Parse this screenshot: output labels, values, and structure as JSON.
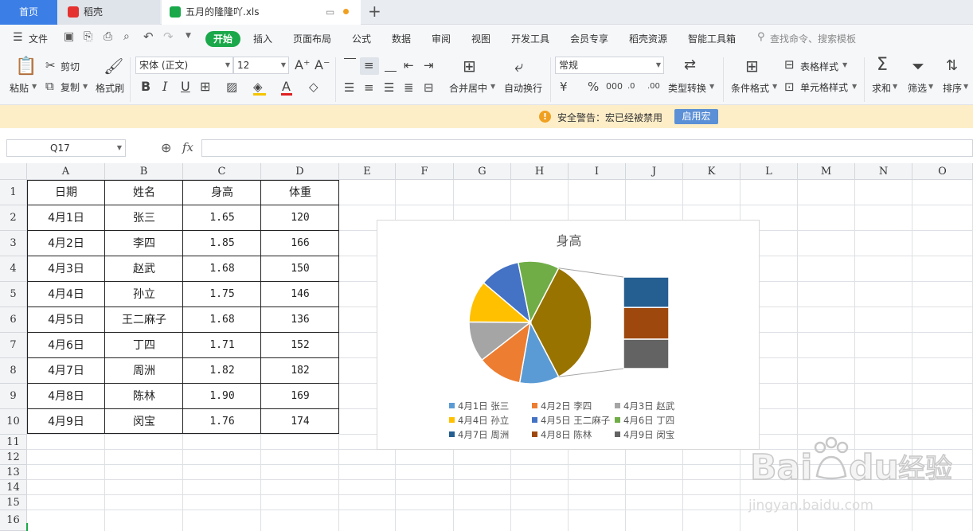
{
  "tabs": [
    {
      "label": "首页"
    },
    {
      "label": "稻壳"
    },
    {
      "label": "五月的隆隆吖.xls"
    }
  ],
  "menu": {
    "file": "文件",
    "items": [
      "开始",
      "插入",
      "页面布局",
      "公式",
      "数据",
      "审阅",
      "视图",
      "开发工具",
      "会员专享",
      "稻壳资源",
      "智能工具箱"
    ],
    "search_placeholder": "查找命令、搜索模板"
  },
  "ribbon": {
    "paste": "粘贴",
    "cut": "剪切",
    "copy": "复制",
    "format_painter": "格式刷",
    "font_name": "宋体 (正文)",
    "font_size": "12",
    "merge": "合并居中",
    "wrap": "自动换行",
    "number_format": "常规",
    "type_convert": "类型转换",
    "cond_format": "条件格式",
    "table_style": "表格样式",
    "cell_style": "单元格样式",
    "sum": "求和",
    "filter": "筛选",
    "sort": "排序"
  },
  "warning": {
    "text": "安全警告：宏已经被禁用",
    "button": "启用宏"
  },
  "formula_bar": {
    "cell_ref": "Q17",
    "fx": "fx",
    "value": ""
  },
  "columns": [
    "A",
    "B",
    "C",
    "D",
    "E",
    "F",
    "G",
    "H",
    "I",
    "J",
    "K",
    "L",
    "M",
    "N",
    "O"
  ],
  "rows": [
    "1",
    "2",
    "3",
    "4",
    "5",
    "6",
    "7",
    "8",
    "9",
    "10",
    "11",
    "12",
    "13",
    "14",
    "15",
    "16"
  ],
  "table": {
    "headers": [
      "日期",
      "姓名",
      "身高",
      "体重"
    ],
    "rows": [
      [
        "4月1日",
        "张三",
        "1.65",
        "120"
      ],
      [
        "4月2日",
        "李四",
        "1.85",
        "166"
      ],
      [
        "4月3日",
        "赵武",
        "1.68",
        "150"
      ],
      [
        "4月4日",
        "孙立",
        "1.75",
        "146"
      ],
      [
        "4月5日",
        "王二麻子",
        "1.68",
        "136"
      ],
      [
        "4月6日",
        "丁四",
        "1.71",
        "152"
      ],
      [
        "4月7日",
        "周洲",
        "1.82",
        "182"
      ],
      [
        "4月8日",
        "陈林",
        "1.90",
        "169"
      ],
      [
        "4月9日",
        "闵宝",
        "1.76",
        "174"
      ]
    ]
  },
  "chart_data": {
    "type": "pie",
    "title": "身高",
    "categories": [
      "4月1日 张三",
      "4月2日 李四",
      "4月3日 赵武",
      "4月4日 孙立",
      "4月5日 王二麻子",
      "4月6日 丁四",
      "4月7日 周洲",
      "4月8日 陈林",
      "4月9日 闵宝"
    ],
    "values": [
      1.65,
      1.85,
      1.68,
      1.75,
      1.68,
      1.71,
      1.82,
      1.9,
      1.76
    ],
    "colors": [
      "#5b9bd5",
      "#ed7d31",
      "#a5a5a5",
      "#ffc000",
      "#4472c4",
      "#70ad47",
      "#255e91",
      "#9e480e",
      "#636363"
    ],
    "secondary_plot": "bar-of-pie",
    "secondary_count": 3,
    "merged_color": "#997300",
    "legend_position": "bottom"
  }
}
